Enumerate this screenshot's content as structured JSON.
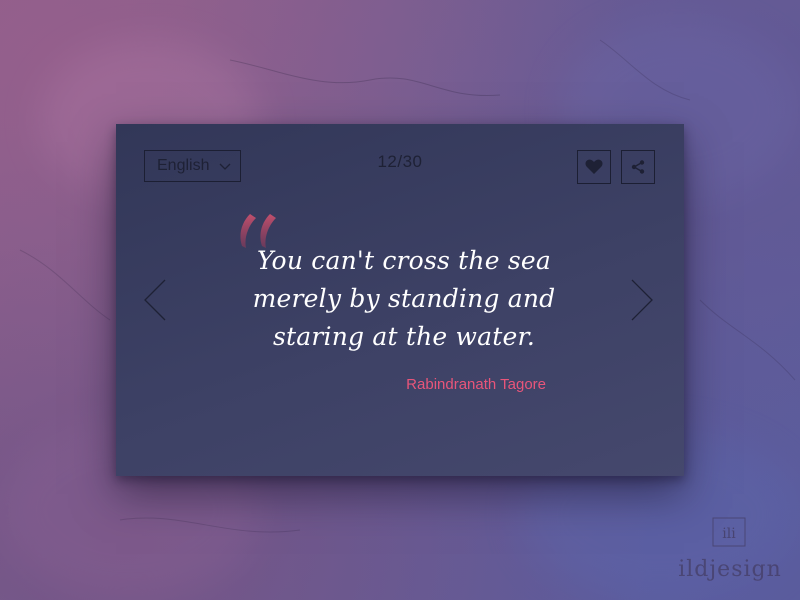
{
  "toolbar": {
    "language": "English",
    "counter": "12/30"
  },
  "quote": {
    "text": "You can't cross the sea merely by standing and staring at the water.",
    "author": "Rabindranath Tagore"
  },
  "watermark": {
    "monogram": "ILI",
    "brand": "ildjesign"
  },
  "colors": {
    "card": "#3a3e62",
    "accent": "#e8557a",
    "quote_mark": "#b34a66",
    "ink": "#1e2135"
  },
  "icons": [
    "chevron-down-icon",
    "heart-icon",
    "share-icon",
    "chevron-left-icon",
    "chevron-right-icon",
    "quote-mark-icon"
  ]
}
